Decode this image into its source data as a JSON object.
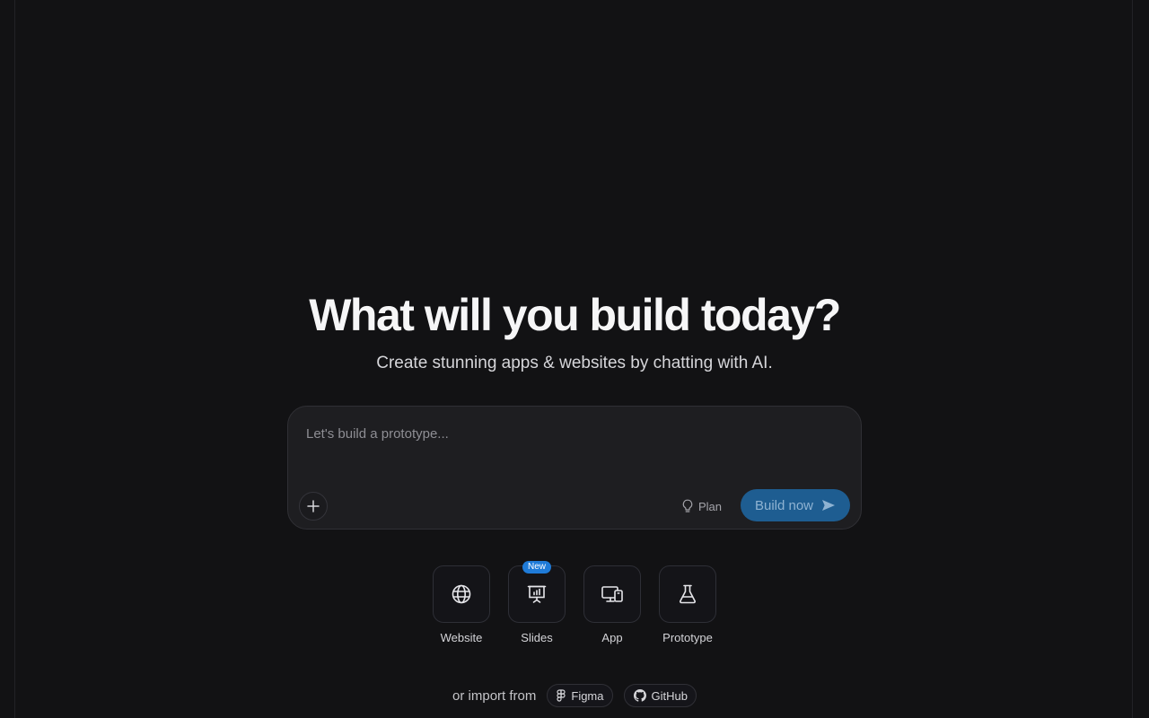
{
  "hero": {
    "title": "What will you build today?",
    "subtitle": "Create stunning apps & websites by chatting with AI."
  },
  "prompt": {
    "placeholder": "Let's build a prototype...",
    "value": "",
    "add_icon": "plus-icon",
    "plan_label": "Plan",
    "plan_icon": "lightbulb-icon",
    "build_label": "Build now",
    "build_icon": "send-icon"
  },
  "types": [
    {
      "label": "Website",
      "icon": "globe-icon"
    },
    {
      "label": "Slides",
      "icon": "presentation-chart-icon",
      "badge": "New"
    },
    {
      "label": "App",
      "icon": "devices-icon"
    },
    {
      "label": "Prototype",
      "icon": "flask-icon"
    }
  ],
  "import": {
    "text": "or import from",
    "sources": [
      {
        "label": "Figma",
        "icon": "figma-icon"
      },
      {
        "label": "GitHub",
        "icon": "github-icon"
      }
    ]
  },
  "colors": {
    "background": "#121214",
    "accent": "#1e5d91",
    "badge": "#1f7bd8"
  }
}
